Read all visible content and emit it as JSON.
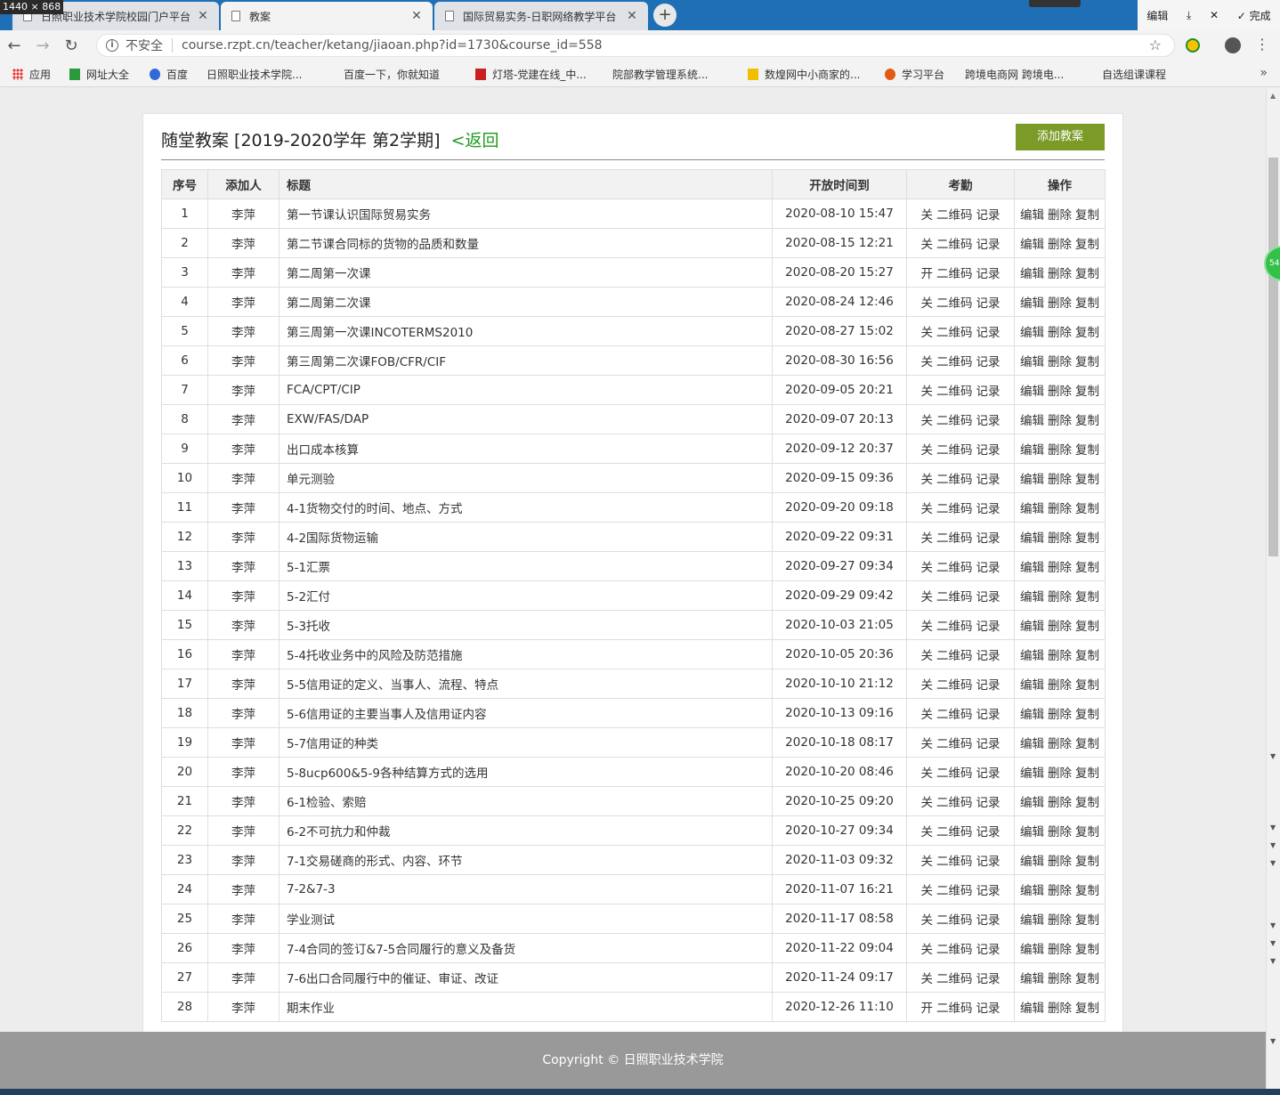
{
  "screen_size_label": "1440 × 868",
  "tabs": [
    {
      "label": "日照职业技术学院校园门户平台",
      "active": false
    },
    {
      "label": "教案",
      "active": true
    },
    {
      "label": "国际贸易实务-日职网络教学平台",
      "active": false
    }
  ],
  "titlebar_actions": {
    "edit": "编辑",
    "download": "⤓",
    "close": "✕",
    "done": "✓ 完成"
  },
  "address": {
    "insecure": "不安全",
    "url": "course.rzpt.cn/teacher/ketang/jiaoan.php?id=1730&course_id=558"
  },
  "bookmarks": [
    {
      "label": "应用",
      "icon": "grid"
    },
    {
      "label": "网址大全",
      "icon": "green"
    },
    {
      "label": "百度",
      "icon": "paw"
    },
    {
      "label": "日照职业技术学院...",
      "icon": "page"
    },
    {
      "label": "百度一下，你就知道",
      "icon": "page"
    },
    {
      "label": "灯塔-党建在线_中...",
      "icon": "red"
    },
    {
      "label": "院部教学管理系统...",
      "icon": "page"
    },
    {
      "label": "数煌网中小商家的...",
      "icon": "dh"
    },
    {
      "label": "学习平台",
      "icon": "fire"
    },
    {
      "label": "跨境电商网 跨境电...",
      "icon": "page"
    },
    {
      "label": "自选组课课程",
      "icon": "page"
    }
  ],
  "header": {
    "title": "随堂教案 [2019-2020学年 第2学期]",
    "back_label": "<返回",
    "add_button": "添加教案"
  },
  "table": {
    "columns": [
      "序号",
      "添加人",
      "标题",
      "开放时间到",
      "考勤",
      "操作"
    ],
    "attendance": {
      "qr": "二维码",
      "record": "记录"
    },
    "ops": {
      "edit": "编辑",
      "delete": "删除",
      "copy": "复制"
    },
    "rows": [
      {
        "no": "1",
        "author": "李萍",
        "title": "第一节课认识国际贸易实务",
        "time": "2020-08-10 15:47",
        "status": "关"
      },
      {
        "no": "2",
        "author": "李萍",
        "title": "第二节课合同标的货物的品质和数量",
        "time": "2020-08-15 12:21",
        "status": "关"
      },
      {
        "no": "3",
        "author": "李萍",
        "title": "第二周第一次课",
        "time": "2020-08-20 15:27",
        "status": "开"
      },
      {
        "no": "4",
        "author": "李萍",
        "title": "第二周第二次课",
        "time": "2020-08-24 12:46",
        "status": "关"
      },
      {
        "no": "5",
        "author": "李萍",
        "title": "第三周第一次课INCOTERMS2010",
        "time": "2020-08-27 15:02",
        "status": "关"
      },
      {
        "no": "6",
        "author": "李萍",
        "title": "第三周第二次课FOB/CFR/CIF",
        "time": "2020-08-30 16:56",
        "status": "关"
      },
      {
        "no": "7",
        "author": "李萍",
        "title": "FCA/CPT/CIP",
        "time": "2020-09-05 20:21",
        "status": "关"
      },
      {
        "no": "8",
        "author": "李萍",
        "title": "EXW/FAS/DAP",
        "time": "2020-09-07 20:13",
        "status": "关"
      },
      {
        "no": "9",
        "author": "李萍",
        "title": "出口成本核算",
        "time": "2020-09-12 20:37",
        "status": "关"
      },
      {
        "no": "10",
        "author": "李萍",
        "title": "单元测验",
        "time": "2020-09-15 09:36",
        "status": "关"
      },
      {
        "no": "11",
        "author": "李萍",
        "title": "4-1货物交付的时间、地点、方式",
        "time": "2020-09-20 09:18",
        "status": "关"
      },
      {
        "no": "12",
        "author": "李萍",
        "title": "4-2国际货物运输",
        "time": "2020-09-22 09:31",
        "status": "关"
      },
      {
        "no": "13",
        "author": "李萍",
        "title": "5-1汇票",
        "time": "2020-09-27 09:34",
        "status": "关"
      },
      {
        "no": "14",
        "author": "李萍",
        "title": "5-2汇付",
        "time": "2020-09-29 09:42",
        "status": "关"
      },
      {
        "no": "15",
        "author": "李萍",
        "title": "5-3托收",
        "time": "2020-10-03 21:05",
        "status": "关"
      },
      {
        "no": "16",
        "author": "李萍",
        "title": "5-4托收业务中的风险及防范措施",
        "time": "2020-10-05 20:36",
        "status": "关"
      },
      {
        "no": "17",
        "author": "李萍",
        "title": "5-5信用证的定义、当事人、流程、特点",
        "time": "2020-10-10 21:12",
        "status": "关"
      },
      {
        "no": "18",
        "author": "李萍",
        "title": "5-6信用证的主要当事人及信用证内容",
        "time": "2020-10-13 09:16",
        "status": "关"
      },
      {
        "no": "19",
        "author": "李萍",
        "title": "5-7信用证的种类",
        "time": "2020-10-18 08:17",
        "status": "关"
      },
      {
        "no": "20",
        "author": "李萍",
        "title": "5-8ucp600&5-9各种结算方式的选用",
        "time": "2020-10-20 08:46",
        "status": "关"
      },
      {
        "no": "21",
        "author": "李萍",
        "title": "6-1检验、索赔",
        "time": "2020-10-25 09:20",
        "status": "关"
      },
      {
        "no": "22",
        "author": "李萍",
        "title": "6-2不可抗力和仲裁",
        "time": "2020-10-27 09:34",
        "status": "关"
      },
      {
        "no": "23",
        "author": "李萍",
        "title": "7-1交易磋商的形式、内容、环节",
        "time": "2020-11-03 09:32",
        "status": "关"
      },
      {
        "no": "24",
        "author": "李萍",
        "title": "7-2&7-3",
        "time": "2020-11-07 16:21",
        "status": "关"
      },
      {
        "no": "25",
        "author": "李萍",
        "title": "学业测试",
        "time": "2020-11-17 08:58",
        "status": "关"
      },
      {
        "no": "26",
        "author": "李萍",
        "title": "7-4合同的签订&7-5合同履行的意义及备货",
        "time": "2020-11-22 09:04",
        "status": "关"
      },
      {
        "no": "27",
        "author": "李萍",
        "title": "7-6出口合同履行中的催证、审证、改证",
        "time": "2020-11-24 09:17",
        "status": "关"
      },
      {
        "no": "28",
        "author": "李萍",
        "title": "期末作业",
        "time": "2020-12-26 11:10",
        "status": "开"
      }
    ]
  },
  "floating_widget": "54",
  "footer": "Copyright © 日照职业技术学院"
}
